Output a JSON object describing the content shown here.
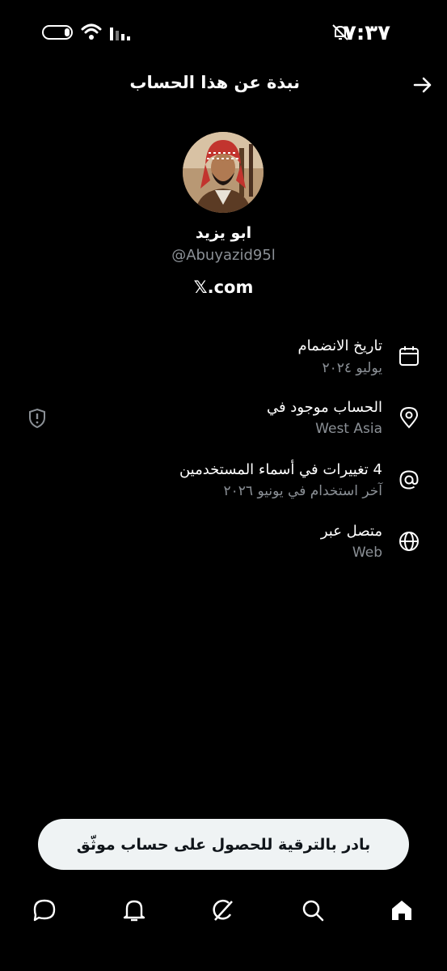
{
  "status_bar": {
    "time": "٧:٣٧"
  },
  "header": {
    "title": "نبذة عن هذا الحساب"
  },
  "profile": {
    "name": "ابو يزيد",
    "handle": "@Abuyazid95l",
    "site": "𝕏.com"
  },
  "rows": [
    {
      "title": "تاريخ الانضمام",
      "sub": "يوليو ٢٠٢٤",
      "icon": "calendar-icon"
    },
    {
      "title": "الحساب موجود في",
      "sub": "West Asia",
      "icon": "location-pin-icon"
    },
    {
      "title": "4 تغييرات في أسماء المستخدمين",
      "sub": "آخر استخدام في يونيو ٢٠٢٦",
      "icon": "at-sign-icon"
    },
    {
      "title": "متصل عبر",
      "sub": "Web",
      "icon": "globe-icon"
    }
  ],
  "upgrade_button": {
    "label": "بادر بالترقية للحصول على حساب موثّق"
  },
  "bottom_nav": [
    "home-icon",
    "search-icon",
    "grok-icon",
    "notifications-icon",
    "messages-icon"
  ],
  "colors": {
    "background": "#000000",
    "secondary_text": "#8b9096",
    "button_bg": "#eff3f4"
  }
}
